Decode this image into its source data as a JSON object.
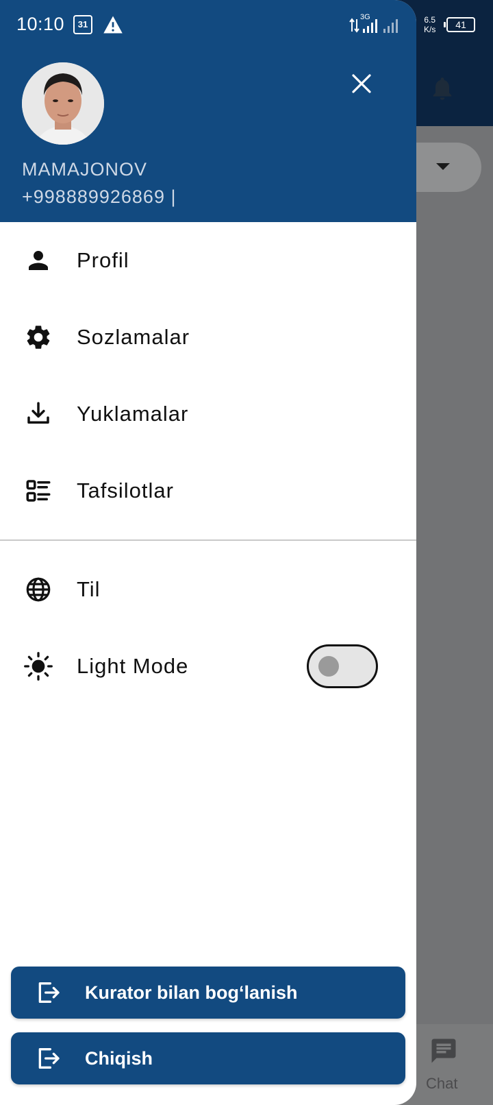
{
  "status_bar": {
    "time": "10:10",
    "calendar_day": "31",
    "network": "3G",
    "speed_value": "6.5",
    "speed_unit": "K/s",
    "battery": "41"
  },
  "background": {
    "bottom_nav_label": "Chat"
  },
  "drawer": {
    "user": {
      "name": "MAMAJONOV",
      "phone": "+998889926869 |"
    },
    "menu": [
      {
        "label": "Profil",
        "icon": "person-icon"
      },
      {
        "label": "Sozlamalar",
        "icon": "gear-icon"
      },
      {
        "label": "Yuklamalar",
        "icon": "download-icon"
      },
      {
        "label": "Tafsilotlar",
        "icon": "list-details-icon"
      }
    ],
    "secondary_menu": [
      {
        "label": "Til",
        "icon": "globe-icon"
      },
      {
        "label": "Light Mode",
        "icon": "sun-icon"
      }
    ],
    "light_mode_toggle": false,
    "buttons": {
      "curator": "Kurator bilan bog‘lanish",
      "logout": "Chiqish"
    }
  },
  "colors": {
    "primary": "#124a80",
    "status_dark": "#0b2340",
    "scrim": "#727375"
  }
}
